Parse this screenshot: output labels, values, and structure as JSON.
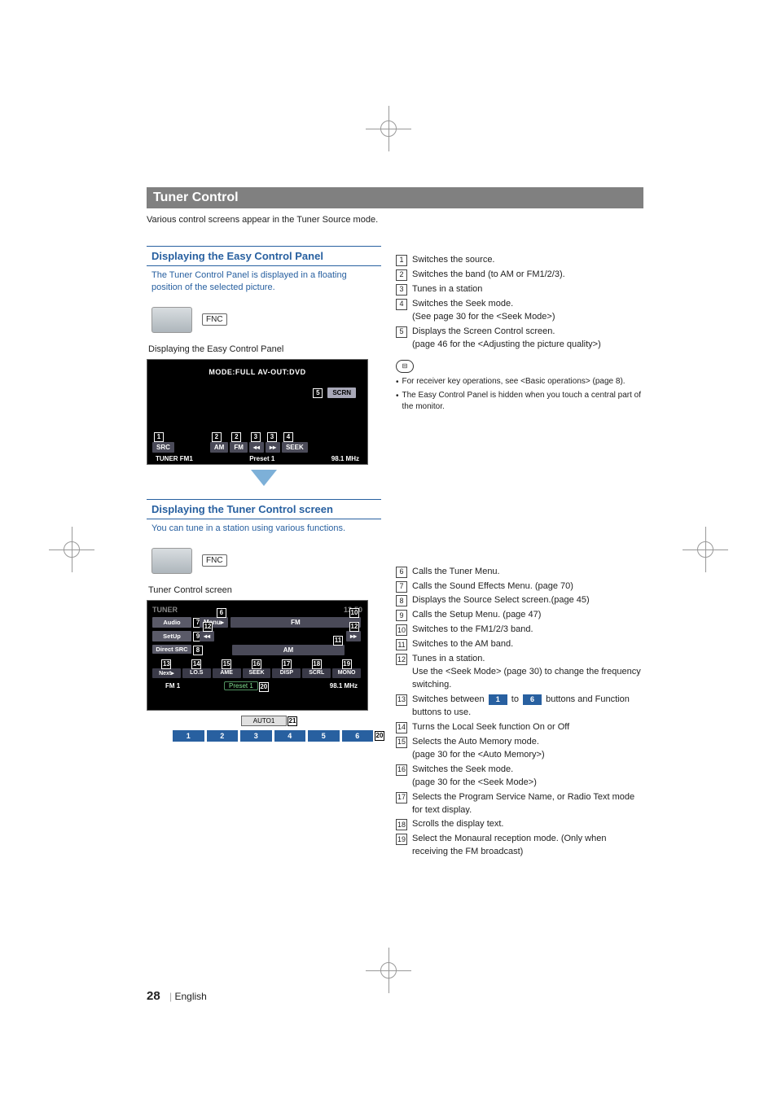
{
  "titlebar": "Tuner Control",
  "intro": "Various control screens appear in the Tuner Source mode.",
  "section1": {
    "heading": "Displaying the Easy Control Panel",
    "sub": "The Tuner Control Panel is displayed in a floating position of the selected picture.",
    "fncLabel": "FNC",
    "caption": "Displaying the Easy Control Panel"
  },
  "scrA": {
    "modeLine": "MODE:FULL   AV-OUT:DVD",
    "scrn": "SCRN",
    "btns": {
      "src": "SRC",
      "am": "AM",
      "fm": "FM",
      "prev": "◂◂",
      "next": "▸▸",
      "seek": "SEEK"
    },
    "statusLeft": "TUNER    FM1",
    "statusMid": "Preset 1",
    "statusRight": "98.1 MHz"
  },
  "section2": {
    "heading": "Displaying the Tuner Control screen",
    "sub": "You can tune in a station using various functions.",
    "fncLabel": "FNC",
    "caption": "Tuner Control screen"
  },
  "scrB": {
    "topLeft": "TUNER",
    "topRight": "13:50",
    "side": {
      "audio": "Audio",
      "setup": "SetUp",
      "direct": "Direct\nSRC"
    },
    "menu": "Menu▸",
    "fm": "FM",
    "am": "AM",
    "prev": "◂◂",
    "next": "▸▸",
    "fn": {
      "next": "Next▸",
      "los": "LO.S",
      "ame": "AME",
      "seek": "SEEK",
      "disp": "DISP",
      "scrl": "SCRL",
      "mono": "MONO"
    },
    "statusLeft": "FM 1",
    "preset": "Preset 1",
    "statusRight": "98.1 MHz",
    "auto": "AUTO1",
    "numTabs": [
      "1",
      "2",
      "3",
      "4",
      "5",
      "6"
    ],
    "numTabCallout": "20"
  },
  "listA": [
    {
      "n": "1",
      "text": "Switches the source."
    },
    {
      "n": "2",
      "text": "Switches the band (to AM or FM1/2/3)."
    },
    {
      "n": "3",
      "text": "Tunes in a station"
    },
    {
      "n": "4",
      "text": "Switches the Seek mode.",
      "sub": "(See page 30 for the <Seek Mode>)"
    },
    {
      "n": "5",
      "text": "Displays the Screen Control screen.",
      "sub": "(page 46 for the <Adjusting the picture quality>)"
    }
  ],
  "notes": [
    "For receiver key operations, see <Basic operations> (page 8).",
    "The Easy Control Panel is hidden when you touch a central part of the monitor."
  ],
  "listB": [
    {
      "n": "6",
      "text": "Calls the Tuner Menu."
    },
    {
      "n": "7",
      "text": "Calls the Sound Effects Menu. (page 70)"
    },
    {
      "n": "8",
      "text": "Displays the Source Select screen.(page 45)"
    },
    {
      "n": "9",
      "text": "Calls the Setup Menu. (page 47)"
    },
    {
      "n": "10",
      "text": "Switches to the FM1/2/3 band."
    },
    {
      "n": "11",
      "text": "Switches to the AM band."
    },
    {
      "n": "12",
      "text": "Tunes in a station.",
      "sub": "Use the <Seek Mode> (page 30) to change the frequency switching."
    },
    {
      "n": "13",
      "pre": "Switches between ",
      "tagA": "1",
      "mid": " to ",
      "tagB": "6",
      "post": " buttons and Function buttons to use."
    },
    {
      "n": "14",
      "text": "Turns the Local Seek function On or Off"
    },
    {
      "n": "15",
      "text": "Selects the Auto Memory mode.",
      "sub": "(page 30 for the <Auto Memory>)"
    },
    {
      "n": "16",
      "text": "Switches the Seek mode.",
      "sub": "(page 30 for the <Seek Mode>)"
    },
    {
      "n": "17",
      "text": "Selects the Program Service Name, or Radio Text mode for text display."
    },
    {
      "n": "18",
      "text": "Scrolls the display text."
    },
    {
      "n": "19",
      "text": "Select the Monaural reception mode. (Only when receiving the FM broadcast)"
    }
  ],
  "footer": {
    "page": "28",
    "lang": "English"
  },
  "callouts": {
    "scrnA": "5",
    "src": "1",
    "am": "2",
    "fm": "2",
    "prev": "3",
    "next": "3",
    "seek": "4",
    "menu": "6",
    "audio": "7",
    "direct": "8",
    "setup": "9",
    "fmB": "10",
    "amB": "11",
    "prevB": "12",
    "nextB": "12",
    "nextFn": "13",
    "los": "14",
    "ame": "15",
    "seekFn": "16",
    "disp": "17",
    "scrl": "18",
    "mono": "19",
    "preset": "20",
    "auto": "21"
  }
}
